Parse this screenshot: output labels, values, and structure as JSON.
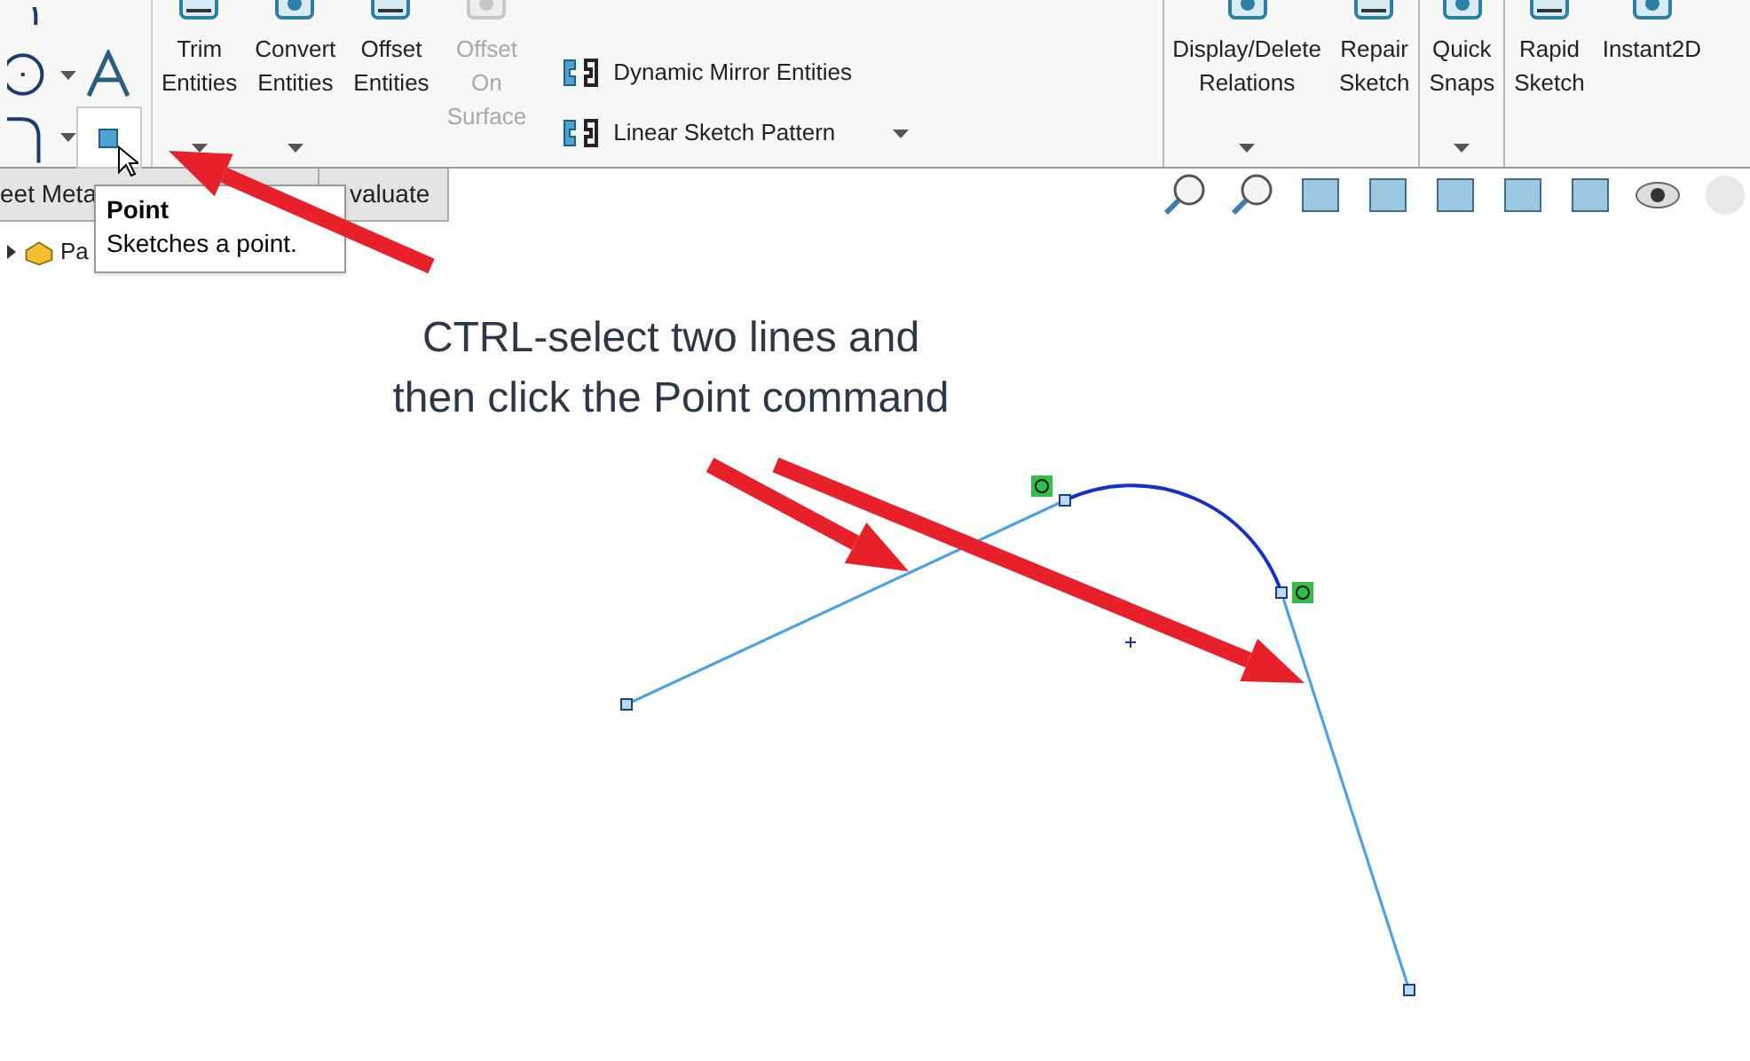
{
  "ribbon": {
    "point_button": {
      "selected": true
    },
    "items": [
      {
        "kind": "large",
        "label": "Trim\nEntities",
        "disabled": false,
        "dropdown": true,
        "group_end": false
      },
      {
        "kind": "large",
        "label": "Convert\nEntities",
        "disabled": false,
        "dropdown": true,
        "group_end": false
      },
      {
        "kind": "large",
        "label": "Offset\nEntities",
        "disabled": false,
        "dropdown": false,
        "group_end": false
      },
      {
        "kind": "large",
        "label": "Offset\nOn\nSurface",
        "disabled": true,
        "dropdown": false,
        "group_end": false
      },
      {
        "kind": "stack",
        "entries": [
          {
            "label": "Dynamic Mirror Entities",
            "dropdown": false
          },
          {
            "label": "Linear Sketch Pattern",
            "dropdown": true
          }
        ],
        "group_end": true
      },
      {
        "kind": "large",
        "label": "Display/Delete\nRelations",
        "disabled": false,
        "dropdown": true,
        "group_end": false
      },
      {
        "kind": "large",
        "label": "Repair\nSketch",
        "disabled": false,
        "dropdown": false,
        "group_end": true
      },
      {
        "kind": "large",
        "label": "Quick\nSnaps",
        "disabled": false,
        "dropdown": true,
        "group_end": true
      },
      {
        "kind": "large",
        "label": "Rapid\nSketch",
        "disabled": false,
        "dropdown": false,
        "group_end": false
      },
      {
        "kind": "large",
        "label": "Instant2D",
        "disabled": false,
        "dropdown": false,
        "group_end": false
      }
    ]
  },
  "tabs": [
    {
      "label": "eet Meta",
      "selected": false
    },
    {
      "label": "valuate",
      "selected": false
    }
  ],
  "tooltip": {
    "title": "Point",
    "text": "Sketches a point."
  },
  "tree": {
    "item": "Pa",
    "expanded": false
  },
  "annotation": "CTRL-select two lines and\nthen click the Point command"
}
